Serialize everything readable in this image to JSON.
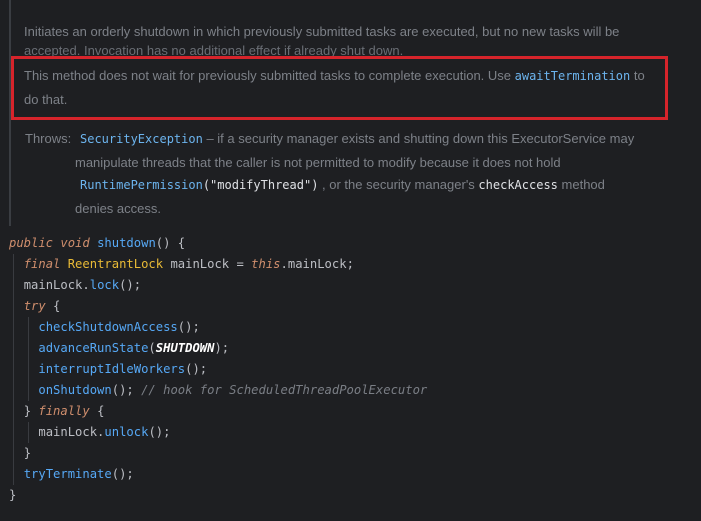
{
  "doc": {
    "para1_line1": "Initiates an orderly shutdown in which previously submitted tasks are executed, but no new tasks will be",
    "para1_line2": "accepted. Invocation has no additional effect if already shut down.",
    "para2_before": "This method does not wait for previously submitted tasks to complete execution. Use ",
    "para2_link": "awaitTermination",
    "para2_after": " to",
    "para2_line2": "do that.",
    "throws_label": "Throws:",
    "throws_exception": "SecurityException",
    "throws_l1_text": " – if a security manager exists and shutting down this ExecutorService may",
    "throws_l2": "manipulate threads that the caller is not permitted to modify because it does not hold",
    "throws_l3_link": "RuntimePermission",
    "throws_l3_arg": "(\"modifyThread\")",
    "throws_l3_mid": " , or the security manager's ",
    "throws_l3_code": "checkAccess",
    "throws_l3_end": " method",
    "throws_l4": "denies access."
  },
  "code": {
    "l1_kw1": "public",
    "l1_kw2": "void",
    "l1_name": "shutdown",
    "l1_rest": "() {",
    "l2_kw": "final",
    "l2_type": "ReentrantLock",
    "l2_var": " mainLock = ",
    "l2_this": "this",
    "l2_rest": ".mainLock;",
    "l3_obj": "mainLock.",
    "l3_call": "lock",
    "l3_rest": "();",
    "l4_kw": "try",
    "l4_rest": " {",
    "l5_call": "checkShutdownAccess",
    "l5_rest": "();",
    "l6_call": "advanceRunState",
    "l6_open": "(",
    "l6_const": "SHUTDOWN",
    "l6_close": ");",
    "l7_call": "interruptIdleWorkers",
    "l7_rest": "();",
    "l8_call": "onShutdown",
    "l8_rest": "(); ",
    "l8_comment": "// hook for ScheduledThreadPoolExecutor",
    "l9_open": "} ",
    "l9_kw": "finally",
    "l9_rest": " {",
    "l10_obj": "mainLock.",
    "l10_call": "unlock",
    "l10_rest": "();",
    "l11": "}",
    "l12_call": "tryTerminate",
    "l12_rest": "();",
    "l13": "}"
  }
}
